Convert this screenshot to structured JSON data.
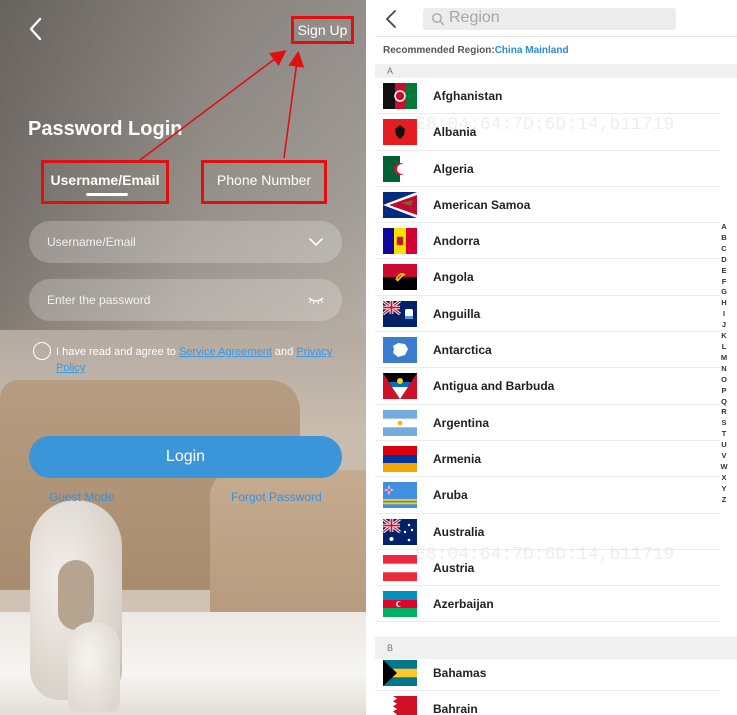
{
  "login": {
    "signup_label": "Sign Up",
    "title": "Password Login",
    "tab_username": "Username/Email",
    "tab_phone": "Phone Number",
    "username_placeholder": "Username/Email",
    "password_placeholder": "Enter the password",
    "agree_prefix": "I have read and agree to ",
    "service_agreement": "Service Agreement",
    "agree_and": " and ",
    "privacy_policy": "Privacy Policy",
    "login_button": "Login",
    "guest_mode": "Guest Mode",
    "forgot_password": "Forgot Password",
    "colors": {
      "annotation_red": "#e01010",
      "login_blue": "#3a96d8",
      "link_blue": "#3a98e8"
    }
  },
  "region": {
    "search_placeholder": "Region",
    "recommended_label": "Recommended Region:",
    "recommended_value": "China Mainland",
    "section_a": "A",
    "section_b": "B",
    "countries_a": [
      {
        "name": "Afghanistan",
        "flag": "afghanistan-flag-icon"
      },
      {
        "name": "Albania",
        "flag": "albania-flag-icon"
      },
      {
        "name": "Algeria",
        "flag": "algeria-flag-icon"
      },
      {
        "name": "American Samoa",
        "flag": "american-samoa-flag-icon"
      },
      {
        "name": "Andorra",
        "flag": "andorra-flag-icon"
      },
      {
        "name": "Angola",
        "flag": "angola-flag-icon"
      },
      {
        "name": "Anguilla",
        "flag": "anguilla-flag-icon"
      },
      {
        "name": "Antarctica",
        "flag": "antarctica-flag-icon"
      },
      {
        "name": "Antigua and Barbuda",
        "flag": "antigua-flag-icon"
      },
      {
        "name": "Argentina",
        "flag": "argentina-flag-icon"
      },
      {
        "name": "Armenia",
        "flag": "armenia-flag-icon"
      },
      {
        "name": "Aruba",
        "flag": "aruba-flag-icon"
      },
      {
        "name": "Australia",
        "flag": "australia-flag-icon"
      },
      {
        "name": "Austria",
        "flag": "austria-flag-icon"
      },
      {
        "name": "Azerbaijan",
        "flag": "azerbaijan-flag-icon"
      }
    ],
    "countries_b": [
      {
        "name": "Bahamas",
        "flag": "bahamas-flag-icon"
      },
      {
        "name": "Bahrain",
        "flag": "bahrain-flag-icon"
      }
    ],
    "alphabet": [
      "A",
      "B",
      "C",
      "D",
      "E",
      "F",
      "G",
      "H",
      "I",
      "J",
      "K",
      "L",
      "M",
      "N",
      "O",
      "P",
      "Q",
      "R",
      "S",
      "T",
      "U",
      "V",
      "W",
      "X",
      "Y",
      "Z"
    ],
    "watermark": "E8:04:64:7D:6D:14,b11719",
    "colors": {
      "accent": "#2a8ad6"
    }
  }
}
